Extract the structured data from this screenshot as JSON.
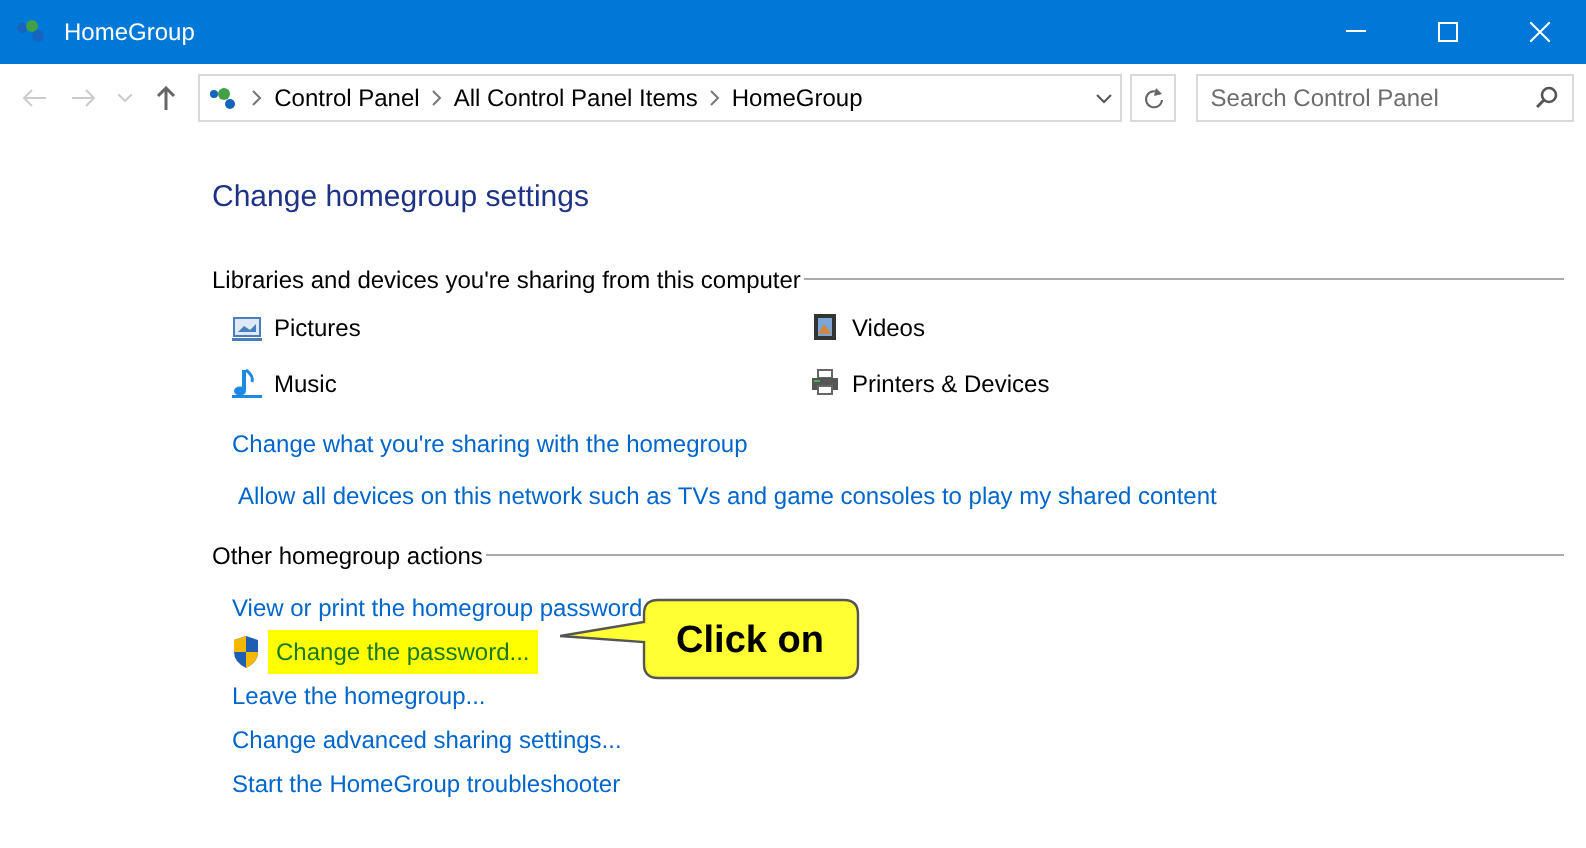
{
  "window": {
    "title": "HomeGroup"
  },
  "breadcrumb": [
    "Control Panel",
    "All Control Panel Items",
    "HomeGroup"
  ],
  "search": {
    "placeholder": "Search Control Panel"
  },
  "heading": "Change homegroup settings",
  "sharing": {
    "title": "Libraries and devices you're sharing from this computer",
    "items": [
      {
        "kind": "pictures",
        "label": "Pictures"
      },
      {
        "kind": "videos",
        "label": "Videos"
      },
      {
        "kind": "music",
        "label": "Music"
      },
      {
        "kind": "printers",
        "label": "Printers & Devices"
      }
    ],
    "links": [
      {
        "label": "Change what you're sharing with the homegroup",
        "indent": false
      },
      {
        "label": "Allow all devices on this network such as TVs and game consoles to play my shared content",
        "indent": true
      }
    ]
  },
  "actions": {
    "title": "Other homegroup actions",
    "links": [
      {
        "label": "View or print the homegroup password",
        "shield": false,
        "highlighted": false
      },
      {
        "label": "Change the password...",
        "shield": true,
        "highlighted": true
      },
      {
        "label": "Leave the homegroup...",
        "shield": false,
        "highlighted": false
      },
      {
        "label": "Change advanced sharing settings...",
        "shield": false,
        "highlighted": false
      },
      {
        "label": "Start the HomeGroup troubleshooter",
        "shield": false,
        "highlighted": false
      }
    ]
  },
  "callout": {
    "text": "Click on"
  }
}
